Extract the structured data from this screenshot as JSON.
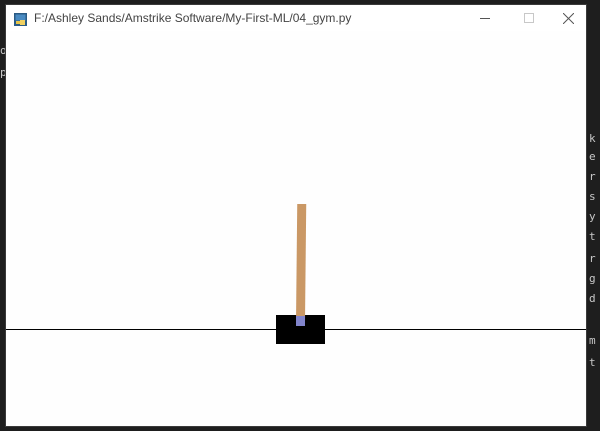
{
  "window": {
    "title": "F:/Ashley Sands/Amstrike Software/My-First-ML/04_gym.py",
    "controls": {
      "minimize": "minimize-icon",
      "maximize": "maximize-icon",
      "close": "close-icon"
    }
  },
  "scene": {
    "track_color": "#000000",
    "cart_color": "#000000",
    "pole_color": "#ca9865",
    "axle_color": "#8184cb",
    "background_color": "#fefefe"
  },
  "background_fragments": {
    "left": [
      "o",
      "p"
    ],
    "right": [
      "k",
      "e",
      "r",
      "s",
      "y",
      "t",
      "r",
      "g",
      "d",
      "m",
      "t"
    ]
  }
}
